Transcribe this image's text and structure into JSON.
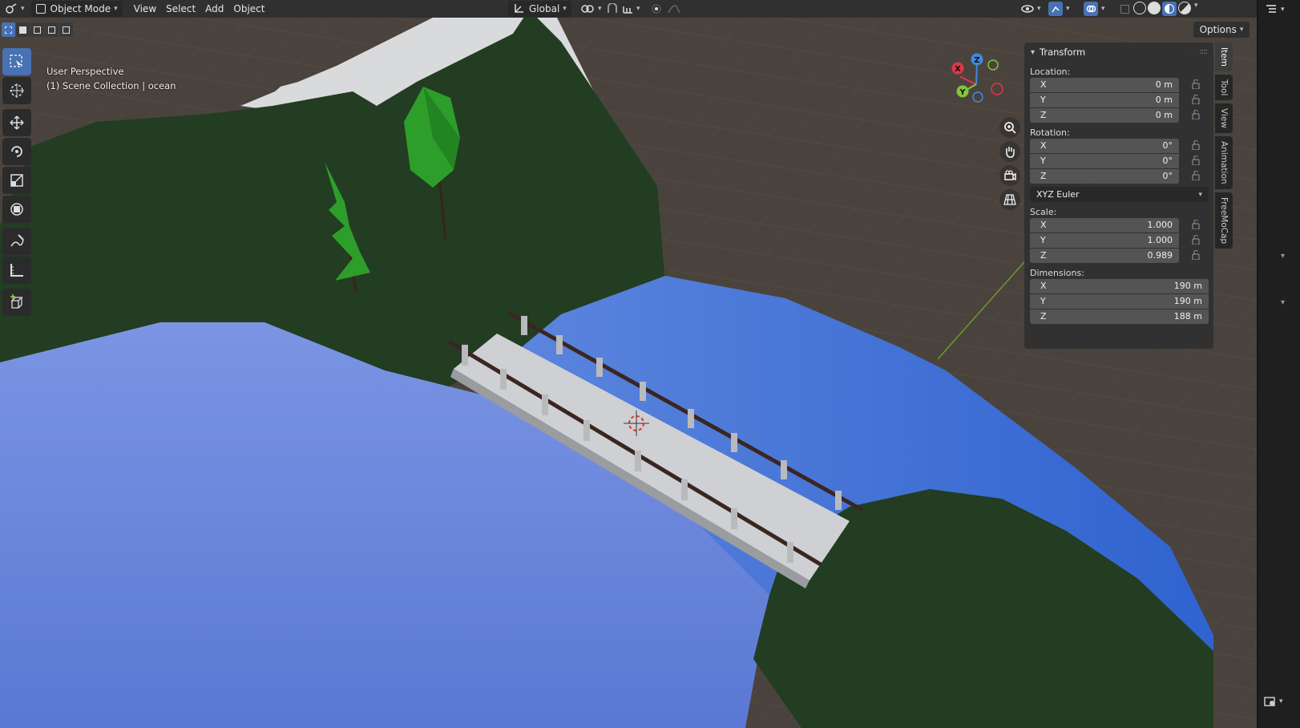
{
  "header": {
    "mode": "Object Mode",
    "menus": [
      "View",
      "Select",
      "Add",
      "Object"
    ],
    "transform_orientation": "Global"
  },
  "options_label": "Options",
  "viewport": {
    "perspective": "User Perspective",
    "collection": "(1) Scene Collection | ocean"
  },
  "gizmo": {
    "x": "X",
    "y": "Y",
    "z": "Z",
    "x_color": "#e0364a",
    "y_color": "#84c43c",
    "z_color": "#3d8ae0"
  },
  "npanel": {
    "title": "Transform",
    "location_label": "Location:",
    "location": [
      {
        "axis": "X",
        "value": "0 m"
      },
      {
        "axis": "Y",
        "value": "0 m"
      },
      {
        "axis": "Z",
        "value": "0 m"
      }
    ],
    "rotation_label": "Rotation:",
    "rotation": [
      {
        "axis": "X",
        "value": "0°"
      },
      {
        "axis": "Y",
        "value": "0°"
      },
      {
        "axis": "Z",
        "value": "0°"
      }
    ],
    "rotation_mode": "XYZ Euler",
    "scale_label": "Scale:",
    "scale": [
      {
        "axis": "X",
        "value": "1.000"
      },
      {
        "axis": "Y",
        "value": "1.000"
      },
      {
        "axis": "Z",
        "value": "0.989"
      }
    ],
    "dimensions_label": "Dimensions:",
    "dimensions": [
      {
        "axis": "X",
        "value": "190 m"
      },
      {
        "axis": "Y",
        "value": "190 m"
      },
      {
        "axis": "Z",
        "value": "188 m"
      }
    ]
  },
  "sidetabs": [
    "Item",
    "Tool",
    "View",
    "Animation",
    "FreeMoCap"
  ],
  "colors": {
    "accent": "#4772b3",
    "water": "#4a78d8",
    "grass": "#223d22",
    "snow": "#d9dadc"
  }
}
